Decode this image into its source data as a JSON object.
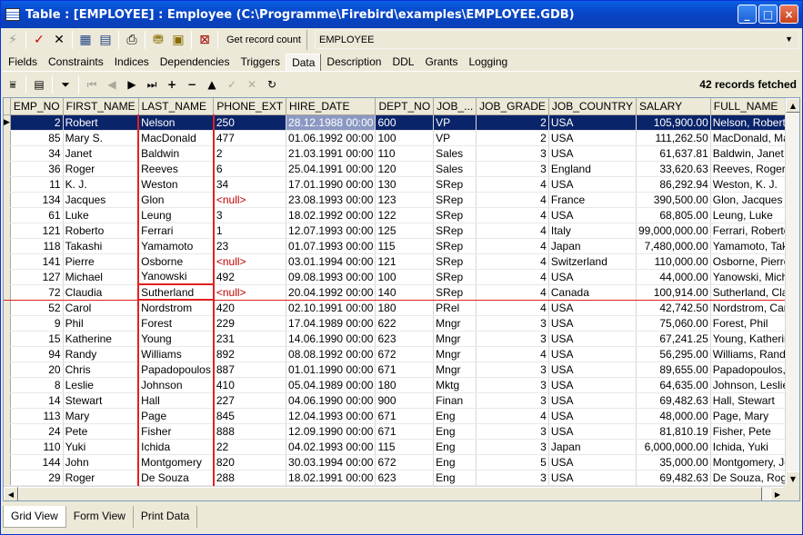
{
  "window": {
    "title": "Table : [EMPLOYEE] : Employee (C:\\Programme\\Firebird\\examples\\EMPLOYEE.GDB)",
    "minimize": "_",
    "maximize": "□",
    "close": "×"
  },
  "toolbar": {
    "get_record_count": "Get record count",
    "table_name": "EMPLOYEE"
  },
  "tabs": [
    "Fields",
    "Constraints",
    "Indices",
    "Dependencies",
    "Triggers",
    "Data",
    "Description",
    "DDL",
    "Grants",
    "Logging"
  ],
  "active_tab": "Data",
  "records_fetched": "42 records fetched",
  "columns": [
    "EMP_NO",
    "FIRST_NAME",
    "LAST_NAME",
    "PHONE_EXT",
    "HIRE_DATE",
    "DEPT_NO",
    "JOB_...",
    "JOB_GRADE",
    "JOB_COUNTRY",
    "SALARY",
    "FULL_NAME"
  ],
  "rows": [
    [
      "2",
      "Robert",
      "Nelson",
      "250",
      "28.12.1988 00:00",
      "600",
      "VP",
      "2",
      "USA",
      "105,900.00",
      "Nelson, Robert"
    ],
    [
      "85",
      "Mary S.",
      "MacDonald",
      "477",
      "01.06.1992 00:00",
      "100",
      "VP",
      "2",
      "USA",
      "111,262.50",
      "MacDonald, Mary"
    ],
    [
      "34",
      "Janet",
      "Baldwin",
      "2",
      "21.03.1991 00:00",
      "110",
      "Sales",
      "3",
      "USA",
      "61,637.81",
      "Baldwin, Janet"
    ],
    [
      "36",
      "Roger",
      "Reeves",
      "6",
      "25.04.1991 00:00",
      "120",
      "Sales",
      "3",
      "England",
      "33,620.63",
      "Reeves, Roger"
    ],
    [
      "11",
      "K. J.",
      "Weston",
      "34",
      "17.01.1990 00:00",
      "130",
      "SRep",
      "4",
      "USA",
      "86,292.94",
      "Weston, K. J."
    ],
    [
      "134",
      "Jacques",
      "Glon",
      "<null>",
      "23.08.1993 00:00",
      "123",
      "SRep",
      "4",
      "France",
      "390,500.00",
      "Glon, Jacques"
    ],
    [
      "61",
      "Luke",
      "Leung",
      "3",
      "18.02.1992 00:00",
      "122",
      "SRep",
      "4",
      "USA",
      "68,805.00",
      "Leung, Luke"
    ],
    [
      "121",
      "Roberto",
      "Ferrari",
      "1",
      "12.07.1993 00:00",
      "125",
      "SRep",
      "4",
      "Italy",
      "99,000,000.00",
      "Ferrari, Roberto"
    ],
    [
      "118",
      "Takashi",
      "Yamamoto",
      "23",
      "01.07.1993 00:00",
      "115",
      "SRep",
      "4",
      "Japan",
      "7,480,000.00",
      "Yamamoto, Takashi"
    ],
    [
      "141",
      "Pierre",
      "Osborne",
      "<null>",
      "03.01.1994 00:00",
      "121",
      "SRep",
      "4",
      "Switzerland",
      "110,000.00",
      "Osborne, Pierre"
    ],
    [
      "127",
      "Michael",
      "Yanowski",
      "492",
      "09.08.1993 00:00",
      "100",
      "SRep",
      "4",
      "USA",
      "44,000.00",
      "Yanowski, Michael"
    ],
    [
      "72",
      "Claudia",
      "Sutherland",
      "<null>",
      "20.04.1992 00:00",
      "140",
      "SRep",
      "4",
      "Canada",
      "100,914.00",
      "Sutherland, Claudia"
    ],
    [
      "52",
      "Carol",
      "Nordstrom",
      "420",
      "02.10.1991 00:00",
      "180",
      "PRel",
      "4",
      "USA",
      "42,742.50",
      "Nordstrom, Carol"
    ],
    [
      "9",
      "Phil",
      "Forest",
      "229",
      "17.04.1989 00:00",
      "622",
      "Mngr",
      "3",
      "USA",
      "75,060.00",
      "Forest, Phil"
    ],
    [
      "15",
      "Katherine",
      "Young",
      "231",
      "14.06.1990 00:00",
      "623",
      "Mngr",
      "3",
      "USA",
      "67,241.25",
      "Young, Katherine"
    ],
    [
      "94",
      "Randy",
      "Williams",
      "892",
      "08.08.1992 00:00",
      "672",
      "Mngr",
      "4",
      "USA",
      "56,295.00",
      "Williams, Randy"
    ],
    [
      "20",
      "Chris",
      "Papadopoulos",
      "887",
      "01.01.1990 00:00",
      "671",
      "Mngr",
      "3",
      "USA",
      "89,655.00",
      "Papadopoulos, Chris"
    ],
    [
      "8",
      "Leslie",
      "Johnson",
      "410",
      "05.04.1989 00:00",
      "180",
      "Mktg",
      "3",
      "USA",
      "64,635.00",
      "Johnson, Leslie"
    ],
    [
      "14",
      "Stewart",
      "Hall",
      "227",
      "04.06.1990 00:00",
      "900",
      "Finan",
      "3",
      "USA",
      "69,482.63",
      "Hall, Stewart"
    ],
    [
      "113",
      "Mary",
      "Page",
      "845",
      "12.04.1993 00:00",
      "671",
      "Eng",
      "4",
      "USA",
      "48,000.00",
      "Page, Mary"
    ],
    [
      "24",
      "Pete",
      "Fisher",
      "888",
      "12.09.1990 00:00",
      "671",
      "Eng",
      "3",
      "USA",
      "81,810.19",
      "Fisher, Pete"
    ],
    [
      "110",
      "Yuki",
      "Ichida",
      "22",
      "04.02.1993 00:00",
      "115",
      "Eng",
      "3",
      "Japan",
      "6,000,000.00",
      "Ichida, Yuki"
    ],
    [
      "144",
      "John",
      "Montgomery",
      "820",
      "30.03.1994 00:00",
      "672",
      "Eng",
      "5",
      "USA",
      "35,000.00",
      "Montgomery, John"
    ],
    [
      "29",
      "Roger",
      "De Souza",
      "288",
      "18.02.1991 00:00",
      "623",
      "Eng",
      "3",
      "USA",
      "69,482.63",
      "De Souza, Roger"
    ]
  ],
  "bottom_tabs": [
    "Grid View",
    "Form View",
    "Print Data"
  ],
  "icons": {
    "toolbar": [
      "lightning-icon",
      "commit-check-icon",
      "rollback-x-icon",
      "grid-options-icon",
      "grid-export-icon",
      "print-icon",
      "filter-icon",
      "refresh-icon",
      "close-table-icon"
    ],
    "grid": [
      "filter-icon",
      "view-icon",
      "filter-funnel-icon",
      "first-record-icon",
      "prior-record-icon",
      "next-record-icon",
      "last-record-icon",
      "insert-icon",
      "delete-icon",
      "edit-icon",
      "post-icon",
      "cancel-icon",
      "refresh-icon"
    ]
  },
  "colors": {
    "selection": "#0a246a",
    "null_text": "#c00000",
    "highlight_border": "#e02020"
  }
}
